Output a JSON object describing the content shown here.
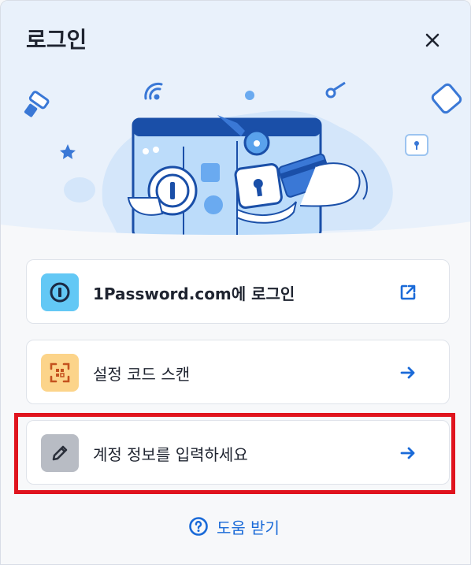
{
  "dialog": {
    "title": "로그인",
    "close_icon": "close-icon"
  },
  "options": [
    {
      "label": "1Password.com에 로그인",
      "icon": "onepassword-logo-icon",
      "icon_bg": "#63c8f5",
      "trailing_icon": "external-link-icon",
      "bold": true
    },
    {
      "label": "설정 코드 스캔",
      "icon": "qr-scan-icon",
      "icon_bg": "#fcd48a",
      "trailing_icon": "arrow-right-icon",
      "bold": false
    },
    {
      "label": "계정 정보를 입력하세요",
      "icon": "pencil-icon",
      "icon_bg": "#b8bcc4",
      "trailing_icon": "arrow-right-icon",
      "bold": false,
      "highlighted": true
    }
  ],
  "help": {
    "label": "도움 받기",
    "icon": "help-circle-icon"
  },
  "colors": {
    "accent": "#1a6ad8",
    "highlight": "#e0141e",
    "hero_bg": "#e9f1fb"
  }
}
